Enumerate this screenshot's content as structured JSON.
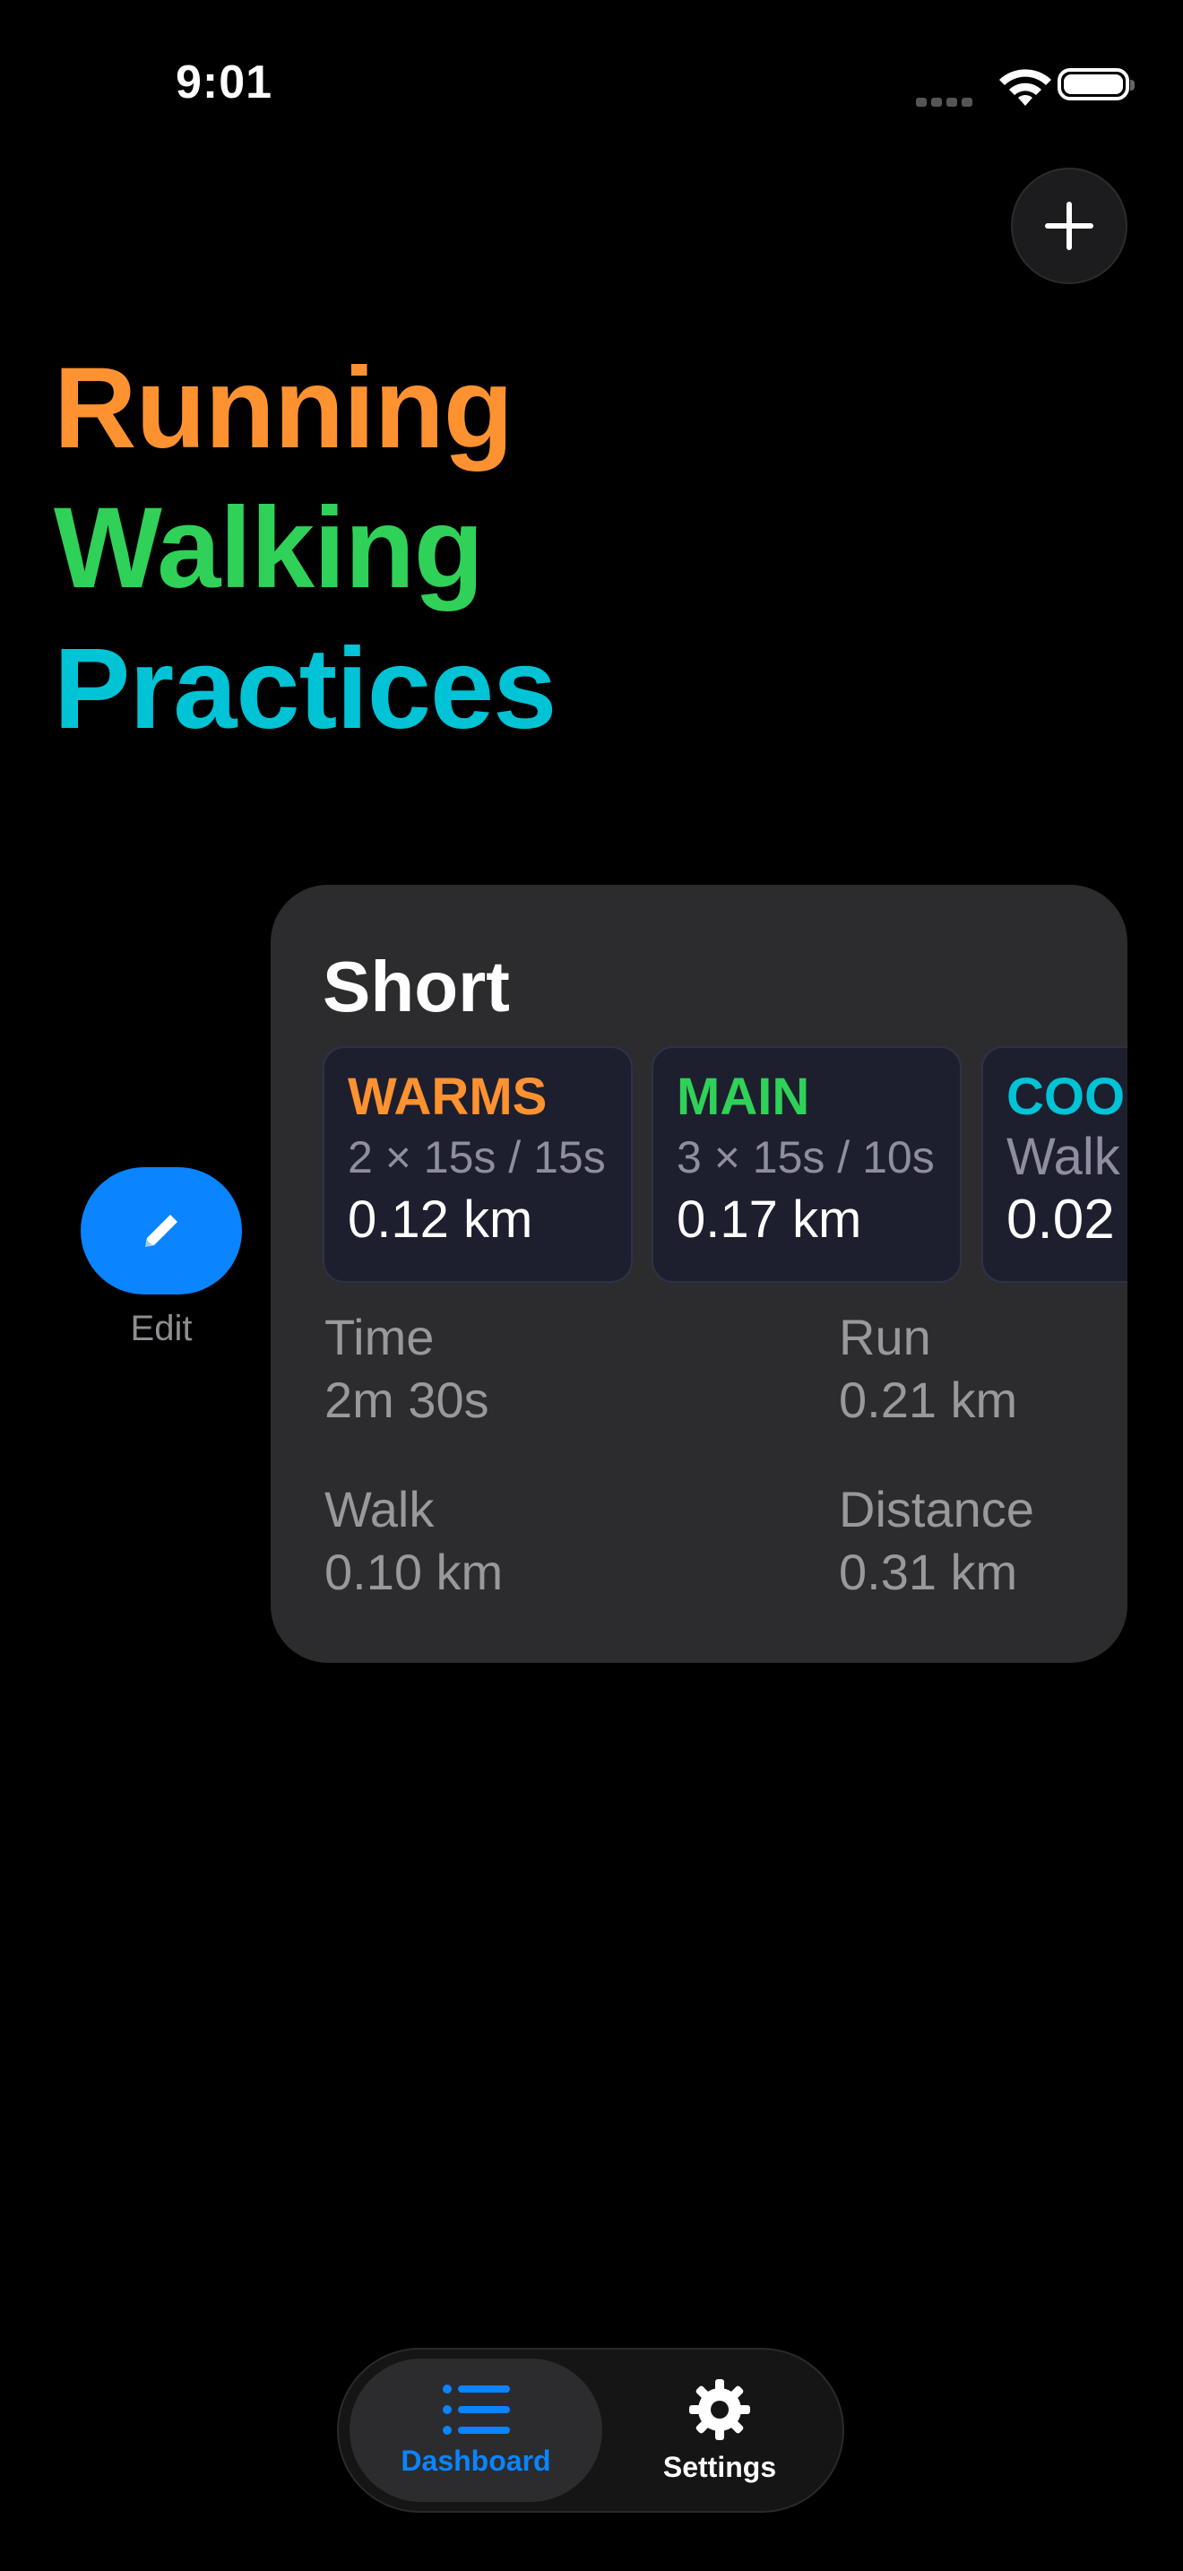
{
  "status_bar": {
    "time": "9:01"
  },
  "header": {
    "add_icon": "plus-icon",
    "title_lines": [
      {
        "text": "Running",
        "color": "#ff9230"
      },
      {
        "text": "Walking",
        "color": "#30d158"
      },
      {
        "text": "Practices",
        "color": "#00c3d6"
      }
    ]
  },
  "edit": {
    "icon": "pencil-icon",
    "label": "Edit"
  },
  "card": {
    "title": "Short",
    "phases": [
      {
        "name": "WARMS",
        "color": "#ff9230",
        "detail": "2 × 15s / 15s",
        "distance": "0.12 km"
      },
      {
        "name": "MAIN",
        "color": "#30d158",
        "detail": "3 × 15s / 10s",
        "distance": "0.17 km"
      },
      {
        "name": "COO",
        "color": "#00c3d6",
        "detail": "Walk",
        "distance": "0.02"
      }
    ],
    "stats": {
      "time": {
        "label": "Time",
        "value": "2m 30s"
      },
      "run": {
        "label": "Run",
        "value": "0.21 km"
      },
      "walk": {
        "label": "Walk",
        "value": "0.10 km"
      },
      "distance": {
        "label": "Distance",
        "value": "0.31 km"
      }
    }
  },
  "tab_bar": {
    "tabs": [
      {
        "label": "Dashboard",
        "icon": "list-icon",
        "selected": true
      },
      {
        "label": "Settings",
        "icon": "gear-icon",
        "selected": false
      }
    ]
  }
}
